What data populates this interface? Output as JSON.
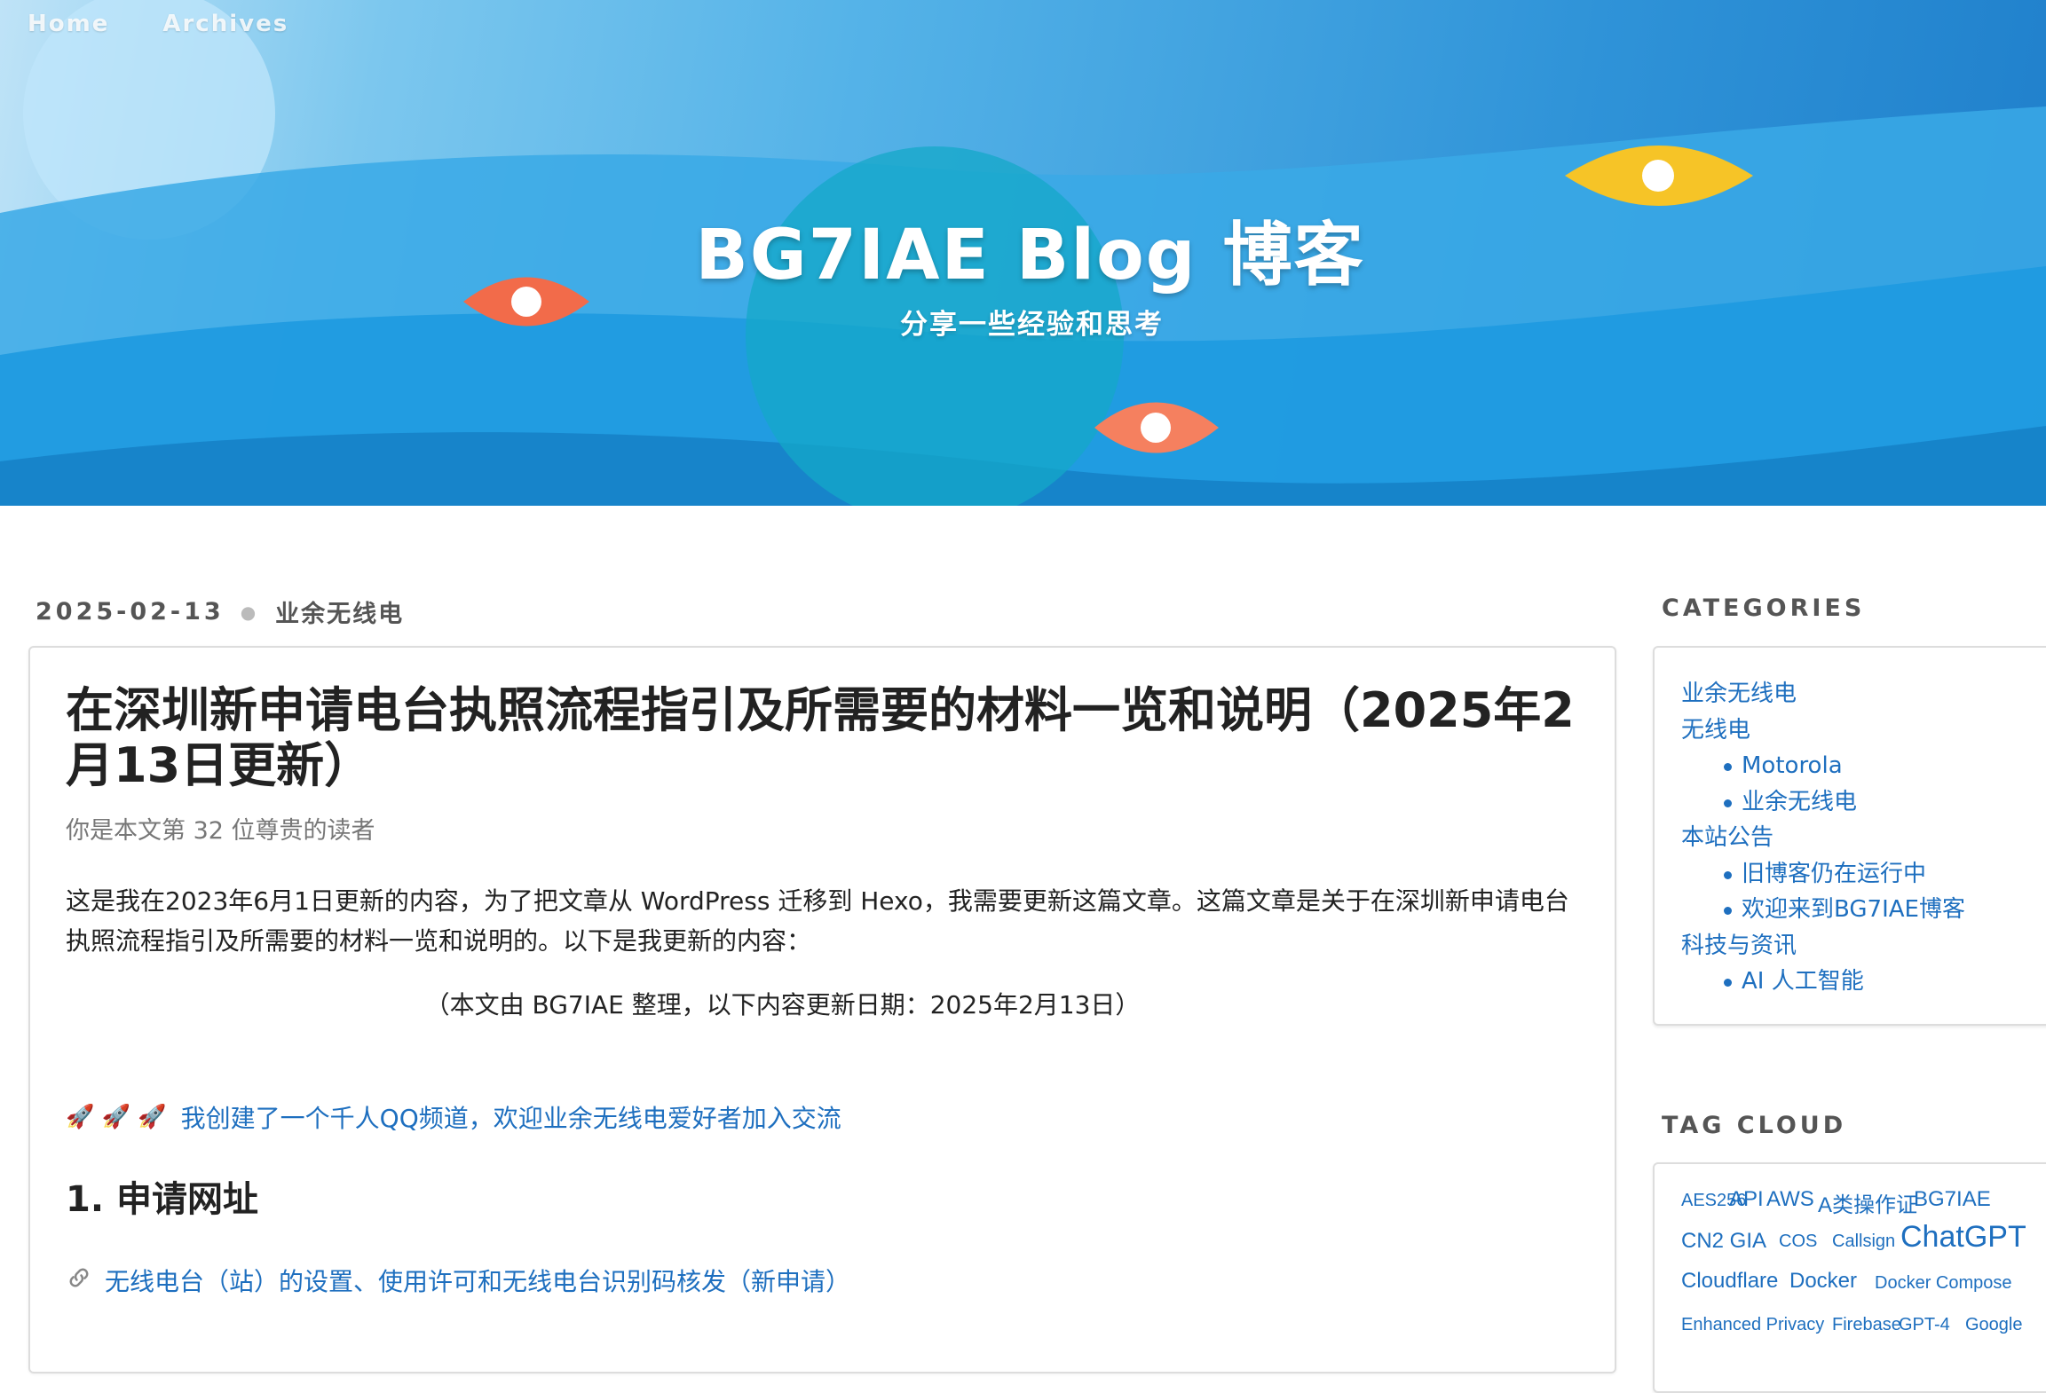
{
  "nav": {
    "home": "Home",
    "archives": "Archives"
  },
  "site": {
    "title": "BG7IAE Blog 博客",
    "subtitle": "分享一些经验和思考"
  },
  "post": {
    "date": "2025-02-13",
    "category": "业余无线电",
    "title": "在深圳新申请电台执照流程指引及所需要的材料一览和说明（2025年2月13日更新）",
    "readers": "你是本文第 32 位尊贵的读者",
    "intro": "这是我在2023年6月1日更新的内容，为了把文章从 WordPress 迁移到 Hexo，我需要更新这篇文章。这篇文章是关于在深圳新申请电台执照流程指引及所需要的材料一览和说明的。以下是我更新的内容：",
    "note": "（本文由 BG7IAE 整理，以下内容更新日期：2025年2月13日）",
    "qq_icons": "🚀 🚀 🚀",
    "qq_link": "我创建了一个千人QQ频道，欢迎业余无线电爱好者加入交流",
    "section1_heading": "1. 申请网址",
    "section1_link": "无线电台（站）的设置、使用许可和无线电台识别码核发（新申请）"
  },
  "sidebar": {
    "categories_heading": "CATEGORIES",
    "categories": [
      {
        "label": "业余无线电",
        "level": 0
      },
      {
        "label": "无线电",
        "level": 0
      },
      {
        "label": "Motorola",
        "level": 1
      },
      {
        "label": "业余无线电",
        "level": 1
      },
      {
        "label": "本站公告",
        "level": 0
      },
      {
        "label": "旧博客仍在运行中",
        "level": 1
      },
      {
        "label": "欢迎来到BG7IAE博客",
        "level": 1
      },
      {
        "label": "科技与资讯",
        "level": 0
      },
      {
        "label": "AI 人工智能",
        "level": 1
      }
    ],
    "tagcloud_heading": "TAG CLOUD",
    "tags": [
      {
        "label": "AES256",
        "size": "small"
      },
      {
        "label": "API",
        "size": "medium"
      },
      {
        "label": "AWS",
        "size": "medium"
      },
      {
        "label": "A类操作证",
        "size": "medium"
      },
      {
        "label": "BG7IAE",
        "size": "medium"
      },
      {
        "label": "CN2 GIA",
        "size": "medium"
      },
      {
        "label": "COS",
        "size": "small"
      },
      {
        "label": "Callsign",
        "size": "small"
      },
      {
        "label": "ChatGPT",
        "size": "large"
      },
      {
        "label": "Cloudflare",
        "size": "medium"
      },
      {
        "label": "Docker",
        "size": "medium"
      },
      {
        "label": "Docker Compose",
        "size": "small"
      },
      {
        "label": "Enhanced Privacy",
        "size": "small"
      },
      {
        "label": "Firebase",
        "size": "small"
      },
      {
        "label": "GPT-4",
        "size": "small"
      },
      {
        "label": "Google",
        "size": "small"
      }
    ]
  },
  "colors": {
    "link": "#1e6fbf",
    "banner_blue": "#2f93d8",
    "eye_orange": "#f26b4a",
    "eye_yellow": "#f6c427"
  }
}
